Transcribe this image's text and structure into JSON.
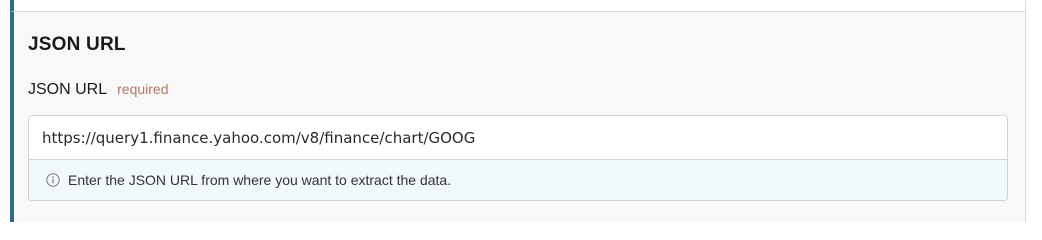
{
  "section": {
    "title": "JSON URL"
  },
  "field": {
    "label": "JSON URL",
    "required_tag": "required",
    "value": "https://query1.finance.yahoo.com/v8/finance/chart/GOOG",
    "help_icon": "info-icon",
    "help_text": "Enter the JSON URL from where you want to extract the data."
  },
  "colors": {
    "accent_bar": "#2f6b8f",
    "required_tag": "#b07866",
    "help_background": "#f2f9fc"
  }
}
